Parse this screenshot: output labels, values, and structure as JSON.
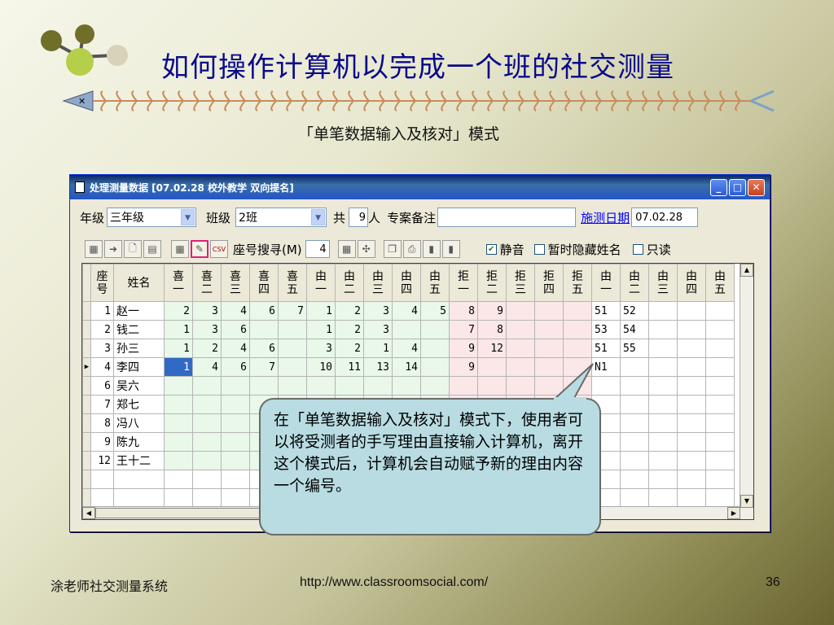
{
  "slide": {
    "title": "如何操作计算机以完成一个班的社交测量",
    "subtitle": "「单笔数据输入及核对」模式",
    "footer_left": "涂老师社交测量系统",
    "footer_center": "http://www.classroomsocial.com/",
    "page_number": "36"
  },
  "window": {
    "title": "处理测量数据 [07.02.28  校外教学  双向提名]",
    "grade_label": "年级",
    "grade_value": "三年级",
    "class_label": "班级",
    "class_value": "2班",
    "total_label": "共",
    "total_value": "9",
    "person_label": "人",
    "remark_label": "专案备注",
    "remark_value": "",
    "date_link": "施测日期",
    "date_value": "07.02.28",
    "seat_search_label": "座号搜寻(M)",
    "seat_search_value": "4",
    "mute_label": "静音",
    "hide_names_label": "暂时隐藏姓名",
    "readonly_label": "只读",
    "csv_label": "CSV"
  },
  "grid": {
    "headers": [
      "座号",
      "姓名",
      "喜一",
      "喜二",
      "喜三",
      "喜四",
      "喜五",
      "由一",
      "由二",
      "由三",
      "由四",
      "由五",
      "拒一",
      "拒二",
      "拒三",
      "拒四",
      "拒五",
      "由一",
      "由二",
      "由三",
      "由四",
      "由五"
    ],
    "rows": [
      [
        "1",
        "赵一",
        "2",
        "3",
        "4",
        "6",
        "7",
        "1",
        "2",
        "3",
        "4",
        "5",
        "8",
        "9",
        "",
        "",
        "",
        "51",
        "52",
        "",
        "",
        ""
      ],
      [
        "2",
        "钱二",
        "1",
        "3",
        "6",
        "",
        "",
        "1",
        "2",
        "3",
        "",
        "",
        "7",
        "8",
        "",
        "",
        "",
        "53",
        "54",
        "",
        "",
        ""
      ],
      [
        "3",
        "孙三",
        "1",
        "2",
        "4",
        "6",
        "",
        "3",
        "2",
        "1",
        "4",
        "",
        "9",
        "12",
        "",
        "",
        "",
        "51",
        "55",
        "",
        "",
        ""
      ],
      [
        "4",
        "李四",
        "1",
        "4",
        "6",
        "7",
        "",
        "10",
        "11",
        "13",
        "14",
        "",
        "9",
        "",
        "",
        "",
        "",
        "N1",
        "",
        "",
        "",
        ""
      ],
      [
        "6",
        "吴六",
        "",
        "",
        "",
        "",
        "",
        "",
        "",
        "",
        "",
        "",
        "",
        "",
        "",
        "",
        "",
        "",
        "",
        "",
        "",
        ""
      ],
      [
        "7",
        "郑七",
        "",
        "",
        "",
        "",
        "",
        "",
        "",
        "",
        "",
        "",
        "",
        "",
        "",
        "",
        "",
        "",
        "",
        "",
        "",
        ""
      ],
      [
        "8",
        "冯八",
        "",
        "",
        "",
        "",
        "",
        "",
        "",
        "",
        "",
        "",
        "",
        "",
        "",
        "",
        "",
        "",
        "",
        "",
        "",
        ""
      ],
      [
        "9",
        "陈九",
        "",
        "",
        "",
        "",
        "",
        "",
        "",
        "",
        "",
        "",
        "",
        "",
        "",
        "",
        "",
        "",
        "",
        "",
        "",
        ""
      ],
      [
        "12",
        "王十二",
        "",
        "",
        "",
        "",
        "",
        "",
        "",
        "",
        "",
        "",
        "",
        "",
        "",
        "",
        "",
        "",
        "",
        "",
        "",
        ""
      ],
      [
        "",
        "",
        "",
        "",
        "",
        "",
        "",
        "",
        "",
        "",
        "",
        "",
        "",
        "",
        "",
        "",
        "",
        "",
        "",
        "",
        "",
        ""
      ],
      [
        "",
        "",
        "",
        "",
        "",
        "",
        "",
        "",
        "",
        "",
        "",
        "",
        "",
        "",
        "",
        "",
        "",
        "",
        "",
        "",
        "",
        ""
      ]
    ]
  },
  "callout": {
    "text": "在「单笔数据输入及核对」模式下，使用者可以将受测者的手写理由直接输入计算机，离开这个模式后，计算机会自动赋予新的理由内容一个编号。"
  }
}
